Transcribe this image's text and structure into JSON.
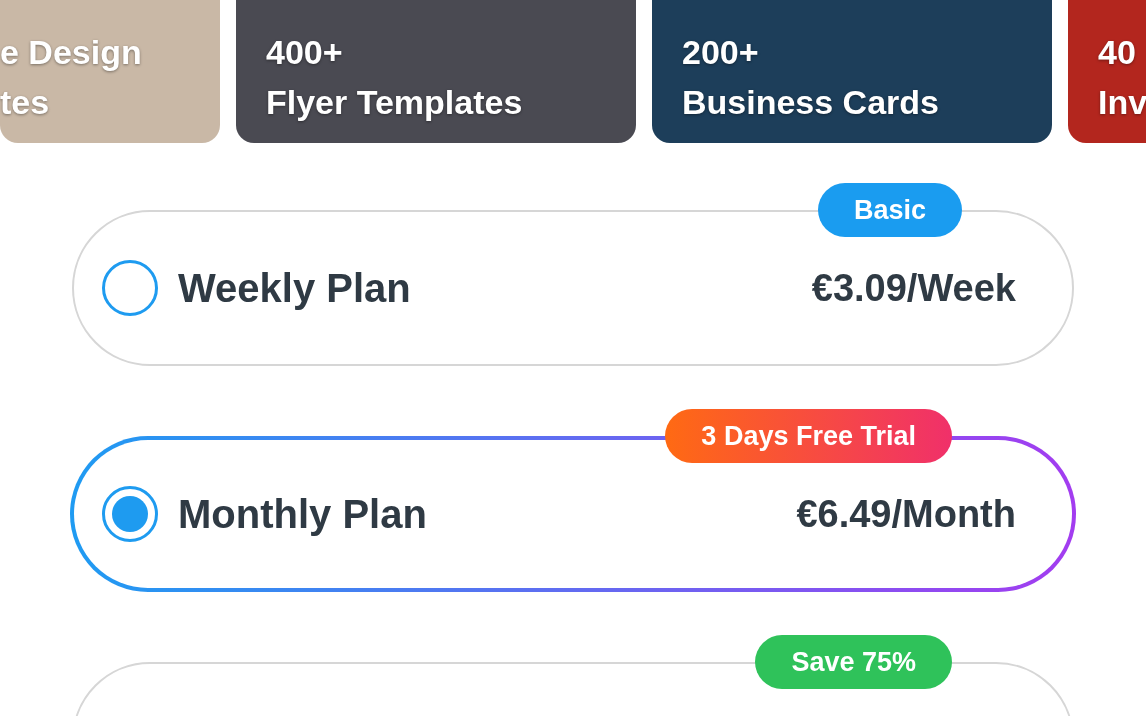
{
  "categories": [
    {
      "lines": [
        "e Design",
        "tes"
      ],
      "cut_left": true,
      "color": "#c9b8a6"
    },
    {
      "lines": [
        "400+",
        "Flyer Templates"
      ],
      "cut_left": false,
      "color": "#4a4a52"
    },
    {
      "lines": [
        "200+",
        "Business Cards"
      ],
      "cut_left": false,
      "color": "#1d3e5a"
    },
    {
      "lines": [
        "40",
        "Inv"
      ],
      "cut_left": false,
      "color": "#b3261e"
    }
  ],
  "plans": [
    {
      "name": "Weekly Plan",
      "price": "€3.09/Week",
      "badge": "Basic",
      "kind": "blue",
      "selected": false
    },
    {
      "name": "Monthly Plan",
      "price": "€6.49/Month",
      "badge": "3 Days Free Trial",
      "kind": "gradient",
      "selected": true
    },
    {
      "badge": "Save 75%",
      "kind": "green"
    }
  ]
}
